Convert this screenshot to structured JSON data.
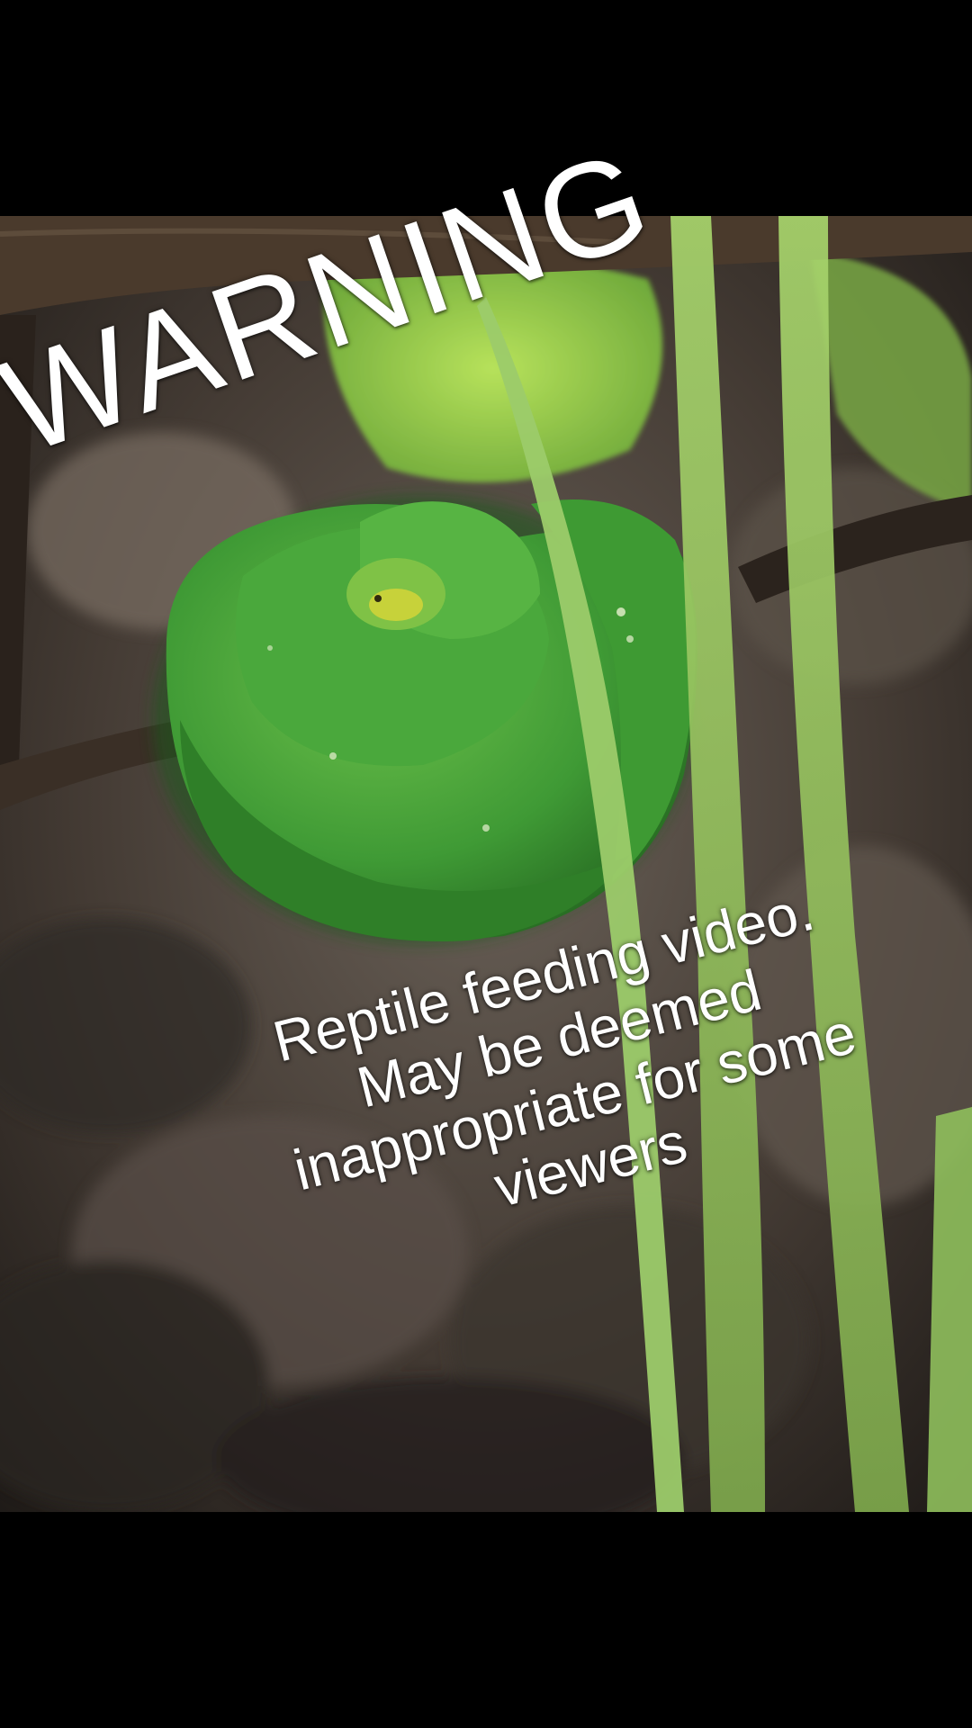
{
  "overlay": {
    "warning_title": "WARNING",
    "caption_lines": [
      "Reptile feeding video.",
      "May be deemed",
      "inappropriate for some",
      "viewers"
    ]
  },
  "scene": {
    "subject": "green-tree-python",
    "colors": {
      "snake": "#3f9a35",
      "snake_highlight": "#6cc04a",
      "leaf": "#9bd04a",
      "grass": "#8fbf5c",
      "branch": "#4a3a2c",
      "substrate": "#4b4139"
    }
  }
}
